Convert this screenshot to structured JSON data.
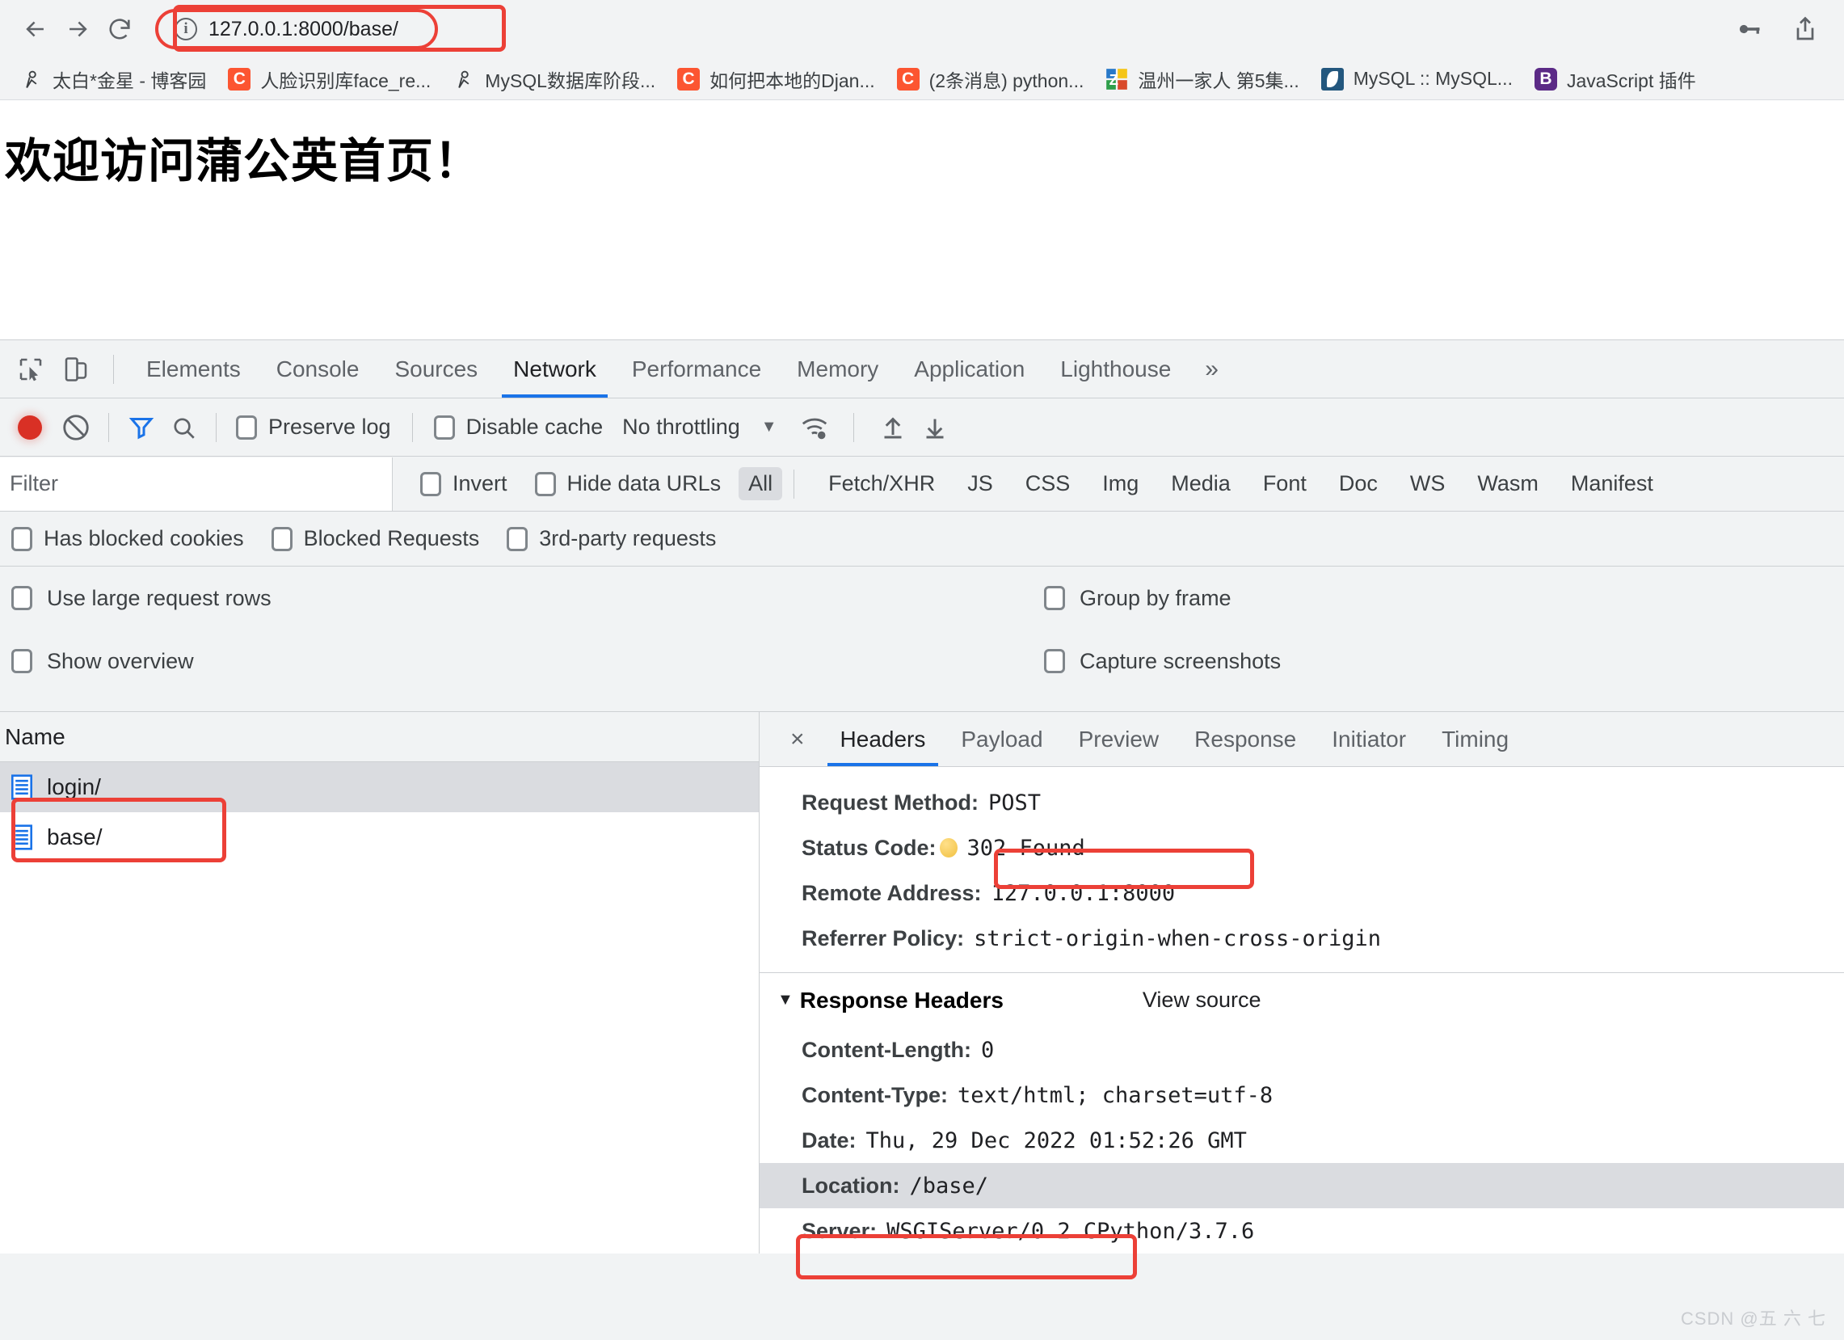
{
  "browser": {
    "nav": {
      "back": "back-arrow",
      "forward": "forward-arrow",
      "reload": "reload"
    },
    "omnibox": {
      "value": "127.0.0.1:8000/base/",
      "info_icon": "info-circle-icon"
    },
    "actions": [
      {
        "name": "password-key-icon"
      },
      {
        "name": "share-icon"
      }
    ],
    "bookmarks": [
      {
        "label": "太白*金星 - 博客园",
        "icon": "person-icon"
      },
      {
        "label": "人脸识别库face_re...",
        "icon": "csdn-c-icon"
      },
      {
        "label": "MySQL数据库阶段...",
        "icon": "person-icon"
      },
      {
        "label": "如何把本地的Djan...",
        "icon": "csdn-c-icon"
      },
      {
        "label": "(2条消息) python...",
        "icon": "csdn-c-icon"
      },
      {
        "label": "温州一家人 第5集...",
        "icon": "zhihu-z-icon"
      },
      {
        "label": "MySQL :: MySQL...",
        "icon": "mysql-dolphin-icon"
      },
      {
        "label": "JavaScript 插件",
        "icon": "bootstrap-b-icon"
      }
    ]
  },
  "page": {
    "heading": "欢迎访问蒲公英首页！"
  },
  "devtools": {
    "toolbar_icons": [
      "inspect-element-icon",
      "device-toolbar-icon"
    ],
    "panels": [
      {
        "label": "Elements",
        "active": false
      },
      {
        "label": "Console",
        "active": false
      },
      {
        "label": "Sources",
        "active": false
      },
      {
        "label": "Network",
        "active": true
      },
      {
        "label": "Performance",
        "active": false
      },
      {
        "label": "Memory",
        "active": false
      },
      {
        "label": "Application",
        "active": false
      },
      {
        "label": "Lighthouse",
        "active": false
      }
    ],
    "more_panels": "»",
    "network_toolbar": {
      "record_title": "record-button",
      "clear_title": "clear-button",
      "filter_title": "filter-button",
      "search_title": "search-button",
      "preserve_log": "Preserve log",
      "disable_cache": "Disable cache",
      "throttling": "No throttling",
      "import_title": "import-har-button",
      "export_title": "export-har-button"
    },
    "filter_bar": {
      "placeholder": "Filter",
      "invert": "Invert",
      "hide_data_urls": "Hide data URLs",
      "types": [
        {
          "label": "All",
          "active": true
        },
        {
          "label": "Fetch/XHR",
          "active": false
        },
        {
          "label": "JS",
          "active": false
        },
        {
          "label": "CSS",
          "active": false
        },
        {
          "label": "Img",
          "active": false
        },
        {
          "label": "Media",
          "active": false
        },
        {
          "label": "Font",
          "active": false
        },
        {
          "label": "Doc",
          "active": false
        },
        {
          "label": "WS",
          "active": false
        },
        {
          "label": "Wasm",
          "active": false
        },
        {
          "label": "Manifest",
          "active": false
        }
      ]
    },
    "blocking_row": [
      "Has blocked cookies",
      "Blocked Requests",
      "3rd-party requests"
    ],
    "prefs": {
      "large_rows": "Use large request rows",
      "group_by_frame": "Group by frame",
      "show_overview": "Show overview",
      "capture_screenshots": "Capture screenshots"
    },
    "requests": {
      "column_name": "Name",
      "rows": [
        {
          "name": "login/",
          "selected": true
        },
        {
          "name": "base/",
          "selected": false
        }
      ]
    },
    "details": {
      "close": "×",
      "tabs": [
        {
          "label": "Headers",
          "active": true
        },
        {
          "label": "Payload",
          "active": false
        },
        {
          "label": "Preview",
          "active": false
        },
        {
          "label": "Response",
          "active": false
        },
        {
          "label": "Initiator",
          "active": false
        },
        {
          "label": "Timing",
          "active": false
        }
      ],
      "general": [
        {
          "key": "Request Method:",
          "value": "POST",
          "status": false,
          "highlight": false
        },
        {
          "key": "Status Code:",
          "value": "302 Found",
          "status": true,
          "highlight": false
        },
        {
          "key": "Remote Address:",
          "value": "127.0.0.1:8000",
          "status": false,
          "highlight": false
        },
        {
          "key": "Referrer Policy:",
          "value": "strict-origin-when-cross-origin",
          "status": false,
          "highlight": false
        }
      ],
      "response_headers_title": "Response Headers",
      "view_source": "View source",
      "response_headers": [
        {
          "key": "Content-Length:",
          "value": "0",
          "highlight": false
        },
        {
          "key": "Content-Type:",
          "value": "text/html; charset=utf-8",
          "highlight": false
        },
        {
          "key": "Date:",
          "value": "Thu, 29 Dec 2022 01:52:26 GMT",
          "highlight": false
        },
        {
          "key": "Location:",
          "value": "/base/",
          "highlight": true
        },
        {
          "key": "Server:",
          "value": "WSGIServer/0.2 CPython/3.7.6",
          "highlight": false
        }
      ]
    }
  },
  "watermark": "CSDN @五 六 七",
  "colors": {
    "annotation": "#ec4037",
    "accent": "#1a73e8",
    "record": "#d93025",
    "devtools_bg": "#f1f3f4"
  }
}
